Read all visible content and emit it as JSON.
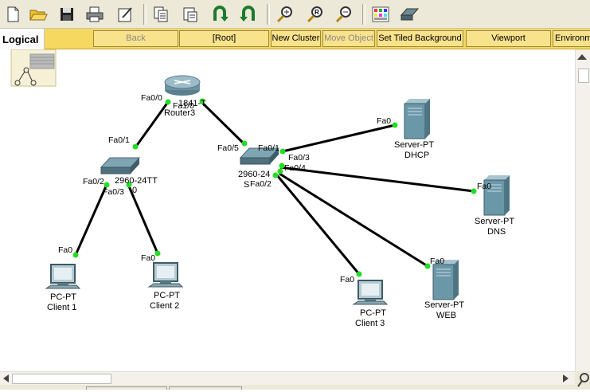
{
  "toolbar": {
    "buttons": [
      "new-file-icon",
      "open-folder-icon",
      "save-icon",
      "print-icon",
      "activity-wizard-icon",
      "copy-icon",
      "paste-icon",
      "undo-icon",
      "redo-icon",
      "zoom-in-icon",
      "zoom-reset-icon",
      "zoom-out-icon",
      "palette-icon",
      "device-template-icon"
    ]
  },
  "navbar": {
    "logical_tab": "Logical",
    "back": "Back",
    "root": "[Root]",
    "new_cluster": "New Cluster",
    "move_object": "Move Object",
    "set_tiled_background": "Set Tiled Background",
    "viewport": "Viewport",
    "environment": "Environm"
  },
  "colors": {
    "link": "#000000",
    "port_dot": "#22dd22",
    "nav_yellow": "#f6d860"
  },
  "devices": {
    "router": {
      "type": "Router",
      "label_partial": "Router3",
      "type_partial": "1841-T"
    },
    "switch0": {
      "type_partial": "2960-24TT",
      "name_partial": "0"
    },
    "switch1": {
      "type_partial": "2960-24",
      "name_partial": "S"
    },
    "client1": {
      "type": "PC-PT",
      "name": "Client 1"
    },
    "client2": {
      "type": "PC-PT",
      "name": "Client 2"
    },
    "client3": {
      "type": "PC-PT",
      "name": "Client 3"
    },
    "dhcp": {
      "type": "Server-PT",
      "name": "DHCP"
    },
    "dns": {
      "type": "Server-PT",
      "name": "DNS"
    },
    "web": {
      "type": "Server-PT",
      "name": "WEB"
    }
  },
  "ports": {
    "router_fa00": "Fa0/0",
    "router_fa10": "Fa1/0",
    "sw0_fa01": "Fa0/1",
    "sw0_fa02": "Fa0/2",
    "sw0_fa03": "Fa0/3",
    "sw1_fa05": "Fa0/5",
    "sw1_fa01": "Fa0/1",
    "sw1_fa03": "Fa0/3",
    "sw1_fa04": "Fa0/4",
    "sw1_fa02": "Fa0/2",
    "client1_fa0": "Fa0",
    "client2_fa0": "Fa0",
    "client3_fa0": "Fa0",
    "dhcp_fa0": "Fa0",
    "dns_fa0": "Fa0",
    "web_fa0": "Fa0"
  }
}
